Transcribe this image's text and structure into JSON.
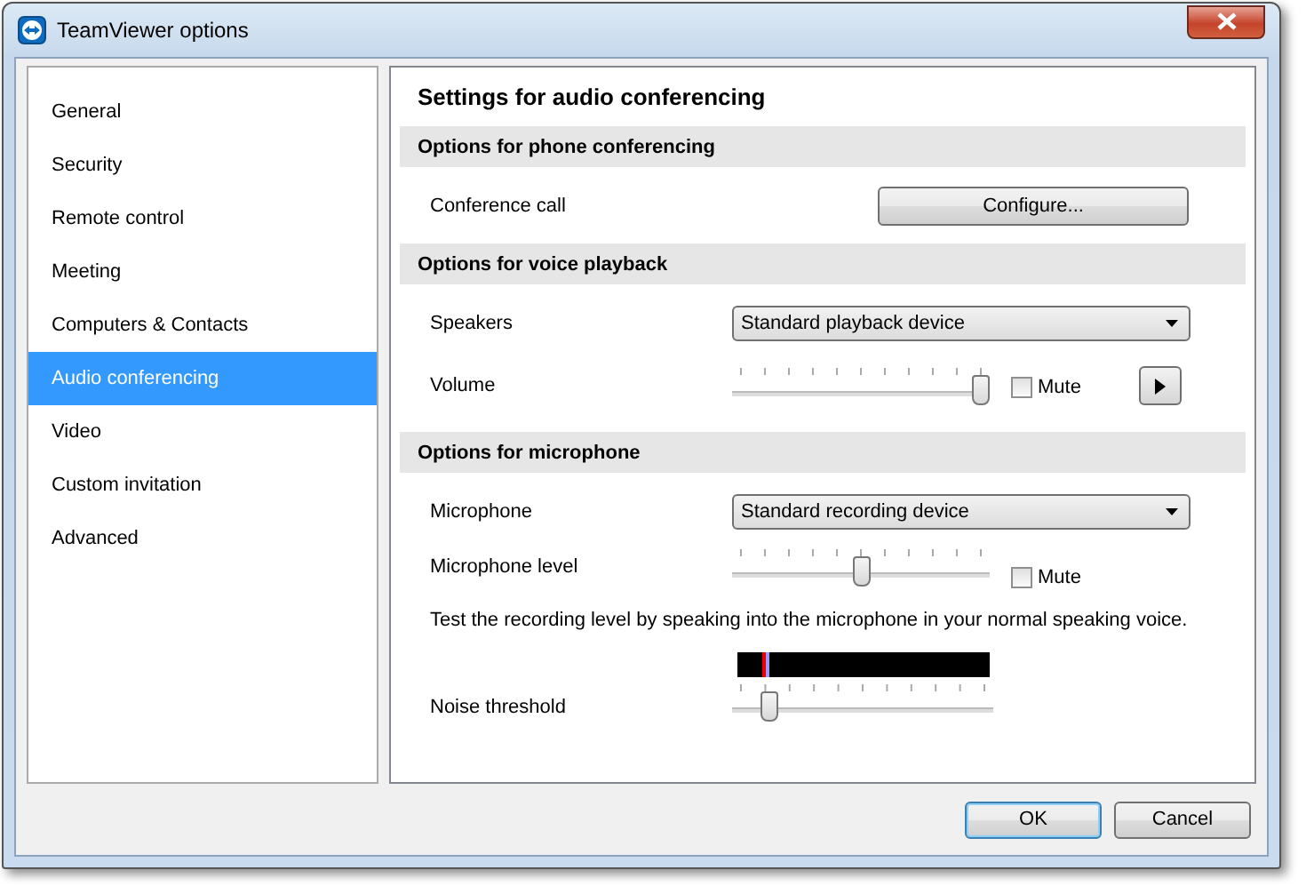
{
  "window": {
    "title": "TeamViewer options"
  },
  "sidebar": {
    "items": [
      {
        "label": "General",
        "selected": false
      },
      {
        "label": "Security",
        "selected": false
      },
      {
        "label": "Remote control",
        "selected": false
      },
      {
        "label": "Meeting",
        "selected": false
      },
      {
        "label": "Computers & Contacts",
        "selected": false
      },
      {
        "label": "Audio conferencing",
        "selected": true
      },
      {
        "label": "Video",
        "selected": false
      },
      {
        "label": "Custom invitation",
        "selected": false
      },
      {
        "label": "Advanced",
        "selected": false
      }
    ]
  },
  "panel": {
    "title": "Settings for audio conferencing",
    "sections": [
      {
        "heading": "Options for phone conferencing",
        "rows": [
          {
            "kind": "button",
            "label": "Conference call",
            "button": "Configure..."
          }
        ]
      },
      {
        "heading": "Options for voice playback",
        "rows": [
          {
            "kind": "dropdown",
            "label": "Speakers",
            "value": "Standard playback device"
          },
          {
            "kind": "slider",
            "label": "Volume",
            "level": 1,
            "mute": {
              "label": "Mute",
              "checked": false
            },
            "play_button": true
          }
        ]
      },
      {
        "heading": "Options for microphone",
        "rows": [
          {
            "kind": "dropdown",
            "label": "Microphone",
            "value": "Standard recording device"
          },
          {
            "kind": "slider",
            "label": "Microphone level",
            "level": 0.5,
            "mute": {
              "label": "Mute",
              "checked": false
            },
            "play_button": false
          },
          {
            "kind": "note",
            "text": "Test the recording level by speaking into the microphone in your normal speaking voice."
          },
          {
            "kind": "meter",
            "level": 0.1
          },
          {
            "kind": "threshold",
            "label": "Noise threshold",
            "level": 0.12
          }
        ]
      }
    ]
  },
  "buttons": [
    {
      "label": "OK",
      "default": true
    },
    {
      "label": "Cancel",
      "default": false
    }
  ]
}
